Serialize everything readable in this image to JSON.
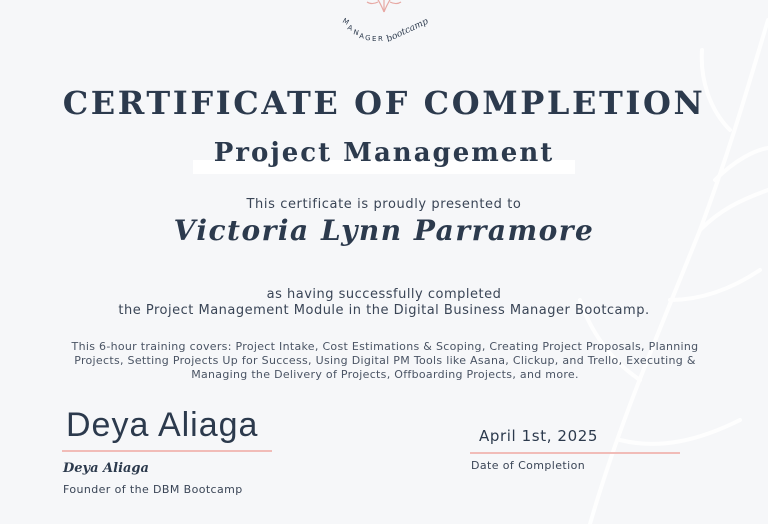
{
  "logo": {
    "text": "MANAGER bootcamp",
    "accent": "#e7a9a4"
  },
  "certificate": {
    "title": "CERTIFICATE OF COMPLETION",
    "course": "Project Management",
    "presented_text": "This certificate is proudly presented to",
    "recipient": "Victoria Lynn Parramore",
    "completion_line_1": "as having successfully completed",
    "completion_line_2": "the Project Management Module in the Digital Business Manager Bootcamp.",
    "description": "This 6-hour training covers: Project Intake, Cost Estimations & Scoping, Creating Project Proposals, Planning Projects, Setting Projects Up for Success, Using Digital PM Tools like Asana, Clickup, and Trello, Executing & Managing the Delivery of Projects, Offboarding Projects, and more."
  },
  "signature": {
    "script": "Deya Aliaga",
    "name": "Deya Aliaga",
    "role": "Founder of the DBM Bootcamp"
  },
  "date": {
    "value": "April 1st, 2025",
    "label": "Date of Completion"
  },
  "colors": {
    "background": "#f6f7f9",
    "text": "#2c3a4d",
    "rule": "#f1bcb8"
  }
}
